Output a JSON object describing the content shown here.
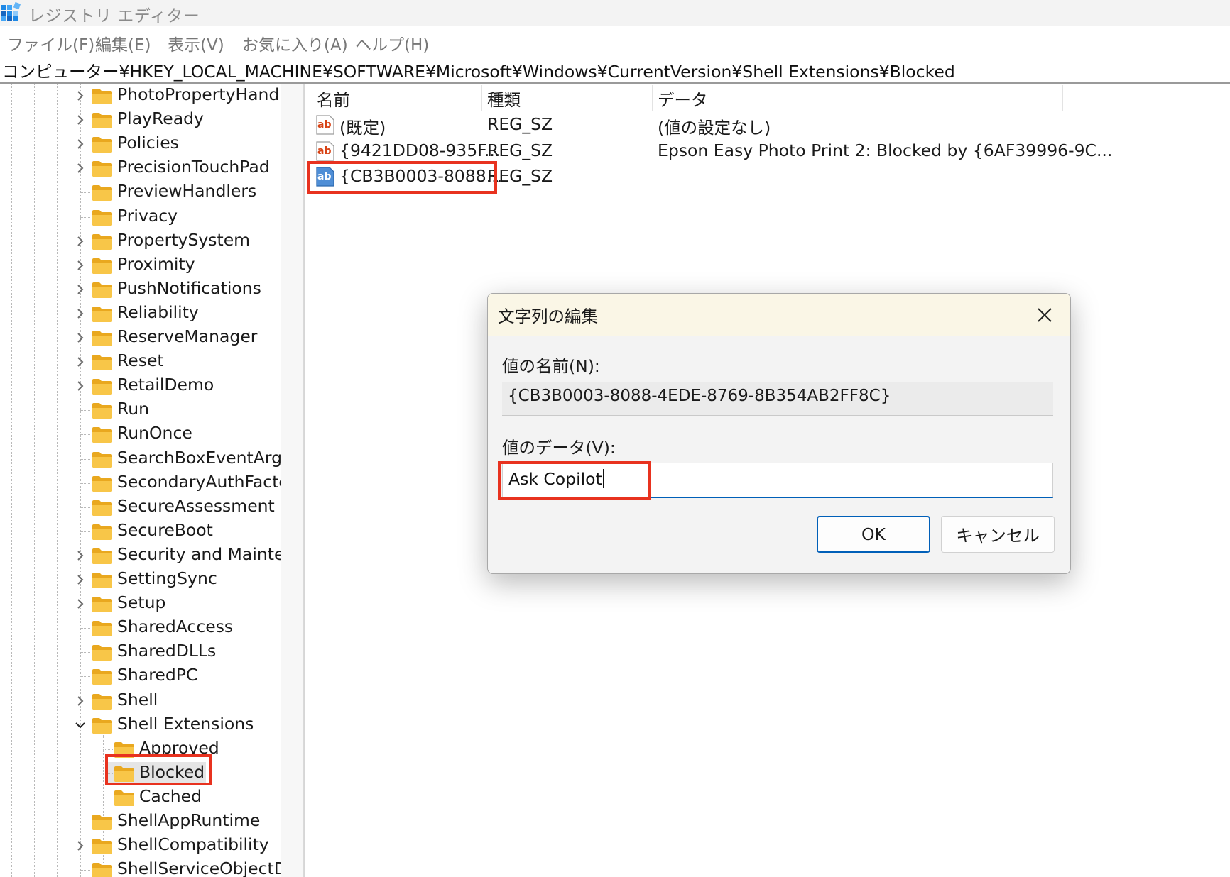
{
  "window": {
    "title": "レジストリ エディター"
  },
  "menu": [
    "ファイル(F)",
    "編集(E)",
    "表示(V)",
    "お気に入り(A)",
    "ヘルプ(H)"
  ],
  "address": "コンピューター¥HKEY_LOCAL_MACHINE¥SOFTWARE¥Microsoft¥Windows¥CurrentVersion¥Shell Extensions¥Blocked",
  "tree": {
    "items": [
      {
        "label": "PhotoPropertyHandle",
        "expander": "collapsed",
        "level": 1
      },
      {
        "label": "PlayReady",
        "expander": "collapsed",
        "level": 1
      },
      {
        "label": "Policies",
        "expander": "collapsed",
        "level": 1
      },
      {
        "label": "PrecisionTouchPad",
        "expander": "collapsed",
        "level": 1
      },
      {
        "label": "PreviewHandlers",
        "expander": "none",
        "level": 1
      },
      {
        "label": "Privacy",
        "expander": "none",
        "level": 1
      },
      {
        "label": "PropertySystem",
        "expander": "collapsed",
        "level": 1
      },
      {
        "label": "Proximity",
        "expander": "collapsed",
        "level": 1
      },
      {
        "label": "PushNotifications",
        "expander": "collapsed",
        "level": 1
      },
      {
        "label": "Reliability",
        "expander": "collapsed",
        "level": 1
      },
      {
        "label": "ReserveManager",
        "expander": "collapsed",
        "level": 1
      },
      {
        "label": "Reset",
        "expander": "collapsed",
        "level": 1
      },
      {
        "label": "RetailDemo",
        "expander": "collapsed",
        "level": 1
      },
      {
        "label": "Run",
        "expander": "none",
        "level": 1
      },
      {
        "label": "RunOnce",
        "expander": "none",
        "level": 1
      },
      {
        "label": "SearchBoxEventArgsP",
        "expander": "none",
        "level": 1
      },
      {
        "label": "SecondaryAuthFactor",
        "expander": "none",
        "level": 1
      },
      {
        "label": "SecureAssessment",
        "expander": "none",
        "level": 1
      },
      {
        "label": "SecureBoot",
        "expander": "none",
        "level": 1
      },
      {
        "label": "Security and Mainten",
        "expander": "collapsed",
        "level": 1
      },
      {
        "label": "SettingSync",
        "expander": "collapsed",
        "level": 1
      },
      {
        "label": "Setup",
        "expander": "collapsed",
        "level": 1
      },
      {
        "label": "SharedAccess",
        "expander": "none",
        "level": 1
      },
      {
        "label": "SharedDLLs",
        "expander": "none",
        "level": 1
      },
      {
        "label": "SharedPC",
        "expander": "none",
        "level": 1
      },
      {
        "label": "Shell",
        "expander": "collapsed",
        "level": 1
      },
      {
        "label": "Shell Extensions",
        "expander": "expanded",
        "level": 1
      },
      {
        "label": "Approved",
        "expander": "none",
        "level": 2
      },
      {
        "label": "Blocked",
        "expander": "none",
        "level": 2,
        "selected": true
      },
      {
        "label": "Cached",
        "expander": "none",
        "level": 2
      },
      {
        "label": "ShellAppRuntime",
        "expander": "none",
        "level": 1
      },
      {
        "label": "ShellCompatibility",
        "expander": "collapsed",
        "level": 1
      },
      {
        "label": "ShellServiceObjectDe",
        "expander": "none",
        "level": 1
      }
    ]
  },
  "list": {
    "headers": {
      "name": "名前",
      "type": "種類",
      "data": "データ"
    },
    "rows": [
      {
        "name": "(既定)",
        "type": "REG_SZ",
        "data": "(値の設定なし)"
      },
      {
        "name": "{9421DD08-935F...",
        "type": "REG_SZ",
        "data": "Epson Easy Photo Print 2: Blocked by {6AF39996-9C..."
      },
      {
        "name": "{CB3B0003-8088...",
        "type": "REG_SZ",
        "data": "",
        "selected": true
      }
    ]
  },
  "dialog": {
    "title": "文字列の編集",
    "name_label": "値の名前(N):",
    "name_value": "{CB3B0003-8088-4EDE-8769-8B354AB2FF8C}",
    "data_label": "値のデータ(V):",
    "data_value": "Ask Copilot",
    "ok_label": "OK",
    "cancel_label": "キャンセル"
  },
  "colors": {
    "highlight": "#e8321f",
    "accent": "#005fb8",
    "folder": "#f8c648",
    "dialog_title_bg": "#faf6e6"
  },
  "icons": {
    "app": "registry-editor-icon",
    "folder": "folder-icon",
    "value": "string-value-ab-icon",
    "close": "close-icon",
    "expander": "chevron-icon"
  }
}
